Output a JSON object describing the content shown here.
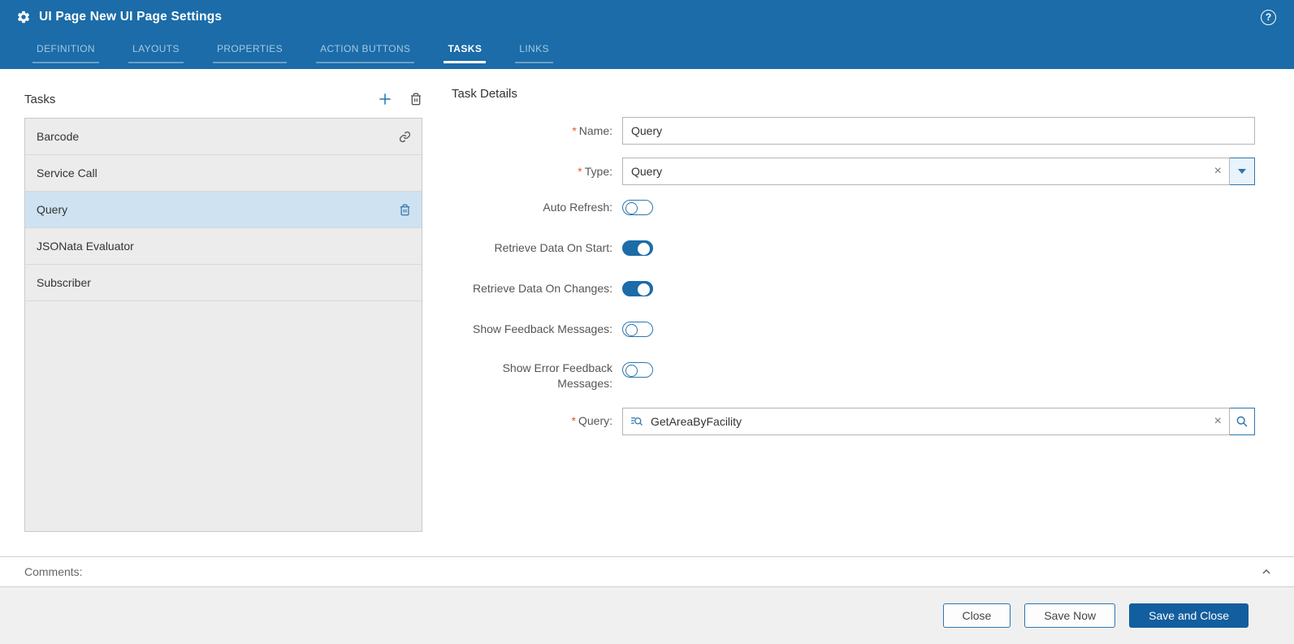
{
  "colors": {
    "header_blue": "#1b6ca8",
    "accent_blue": "#2e75ad",
    "selected_row": "#cfe2f1",
    "toggle_on": "#1b6ca8",
    "primary_button": "#135e9e",
    "required_marker": "#e05a1e"
  },
  "header": {
    "title": "UI Page New UI Page Settings",
    "help_icon": "?"
  },
  "tabs": [
    {
      "label": "DEFINITION",
      "active": false
    },
    {
      "label": "LAYOUTS",
      "active": false
    },
    {
      "label": "PROPERTIES",
      "active": false
    },
    {
      "label": "ACTION BUTTONS",
      "active": false
    },
    {
      "label": "TASKS",
      "active": true
    },
    {
      "label": "LINKS",
      "active": false
    }
  ],
  "tasks_panel": {
    "title": "Tasks",
    "toolbar_icons": [
      "add-icon",
      "trash-icon"
    ],
    "items": [
      {
        "label": "Barcode",
        "selected": false,
        "icon": "link-icon"
      },
      {
        "label": "Service Call",
        "selected": false,
        "icon": ""
      },
      {
        "label": "Query",
        "selected": true,
        "icon": "trash-icon"
      },
      {
        "label": "JSONata Evaluator",
        "selected": false,
        "icon": ""
      },
      {
        "label": "Subscriber",
        "selected": false,
        "icon": ""
      }
    ]
  },
  "details": {
    "title": "Task Details",
    "name": {
      "label": "Name:",
      "required": true,
      "value": "Query"
    },
    "type": {
      "label": "Type:",
      "required": true,
      "value": "Query"
    },
    "auto_refresh": {
      "label": "Auto Refresh:",
      "on": false
    },
    "retrieve_on_start": {
      "label": "Retrieve Data On Start:",
      "on": true
    },
    "retrieve_on_changes": {
      "label": "Retrieve Data On Changes:",
      "on": true
    },
    "show_feedback": {
      "label": "Show Feedback Messages:",
      "on": false
    },
    "show_error_feedback": {
      "label": "Show Error Feedback Messages:",
      "on": false
    },
    "query": {
      "label": "Query:",
      "required": true,
      "value": "GetAreaByFacility"
    }
  },
  "comments": {
    "label": "Comments:"
  },
  "footer": {
    "close": "Close",
    "save_now": "Save Now",
    "save_and_close": "Save and Close"
  }
}
